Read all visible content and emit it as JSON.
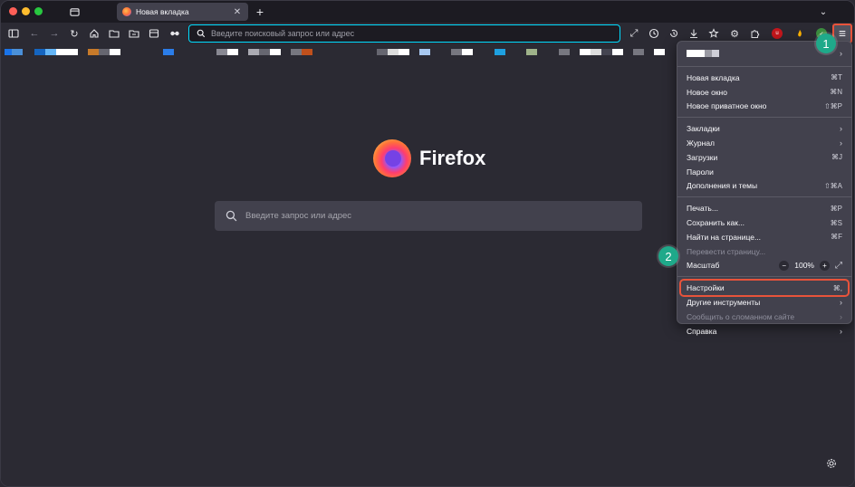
{
  "tab": {
    "title": "Новая вкладка",
    "close": "✕"
  },
  "newtab": "+",
  "tablist": "⌄",
  "urlbar": {
    "placeholder": "Введите поисковый запрос или адрес"
  },
  "content": {
    "brand": "Firefox",
    "search_placeholder": "Введите запрос или адрес"
  },
  "colors": {
    "accent": "#00ddff",
    "highlight": "#e8533b",
    "badge": "#1fa98a"
  },
  "app_menu": {
    "items_group1": [
      {
        "label": "Новая вкладка",
        "shortcut": "⌘T"
      },
      {
        "label": "Новое окно",
        "shortcut": "⌘N"
      },
      {
        "label": "Новое приватное окно",
        "shortcut": "⇧⌘P"
      }
    ],
    "items_group2": [
      {
        "label": "Закладки",
        "shortcut": "›"
      },
      {
        "label": "Журнал",
        "shortcut": "›"
      },
      {
        "label": "Загрузки",
        "shortcut": "⌘J"
      },
      {
        "label": "Пароли",
        "shortcut": ""
      },
      {
        "label": "Дополнения и темы",
        "shortcut": "⇧⌘A"
      }
    ],
    "items_group3": [
      {
        "label": "Печать...",
        "shortcut": "⌘P"
      },
      {
        "label": "Сохранить как...",
        "shortcut": "⌘S"
      },
      {
        "label": "Найти на странице...",
        "shortcut": "⌘F"
      },
      {
        "label": "Перевести страницу...",
        "shortcut": ""
      }
    ],
    "zoom": {
      "label": "Масштаб",
      "minus": "−",
      "value": "100%",
      "plus": "+",
      "fullscreen": "⤢"
    },
    "items_group4": [
      {
        "label": "Настройки",
        "shortcut": "⌘,"
      },
      {
        "label": "Другие инструменты",
        "shortcut": "›"
      },
      {
        "label": "Сообщить о сломанном сайте",
        "shortcut": "›"
      },
      {
        "label": "Справка",
        "shortcut": "›"
      }
    ]
  },
  "badges": {
    "one": "1",
    "two": "2"
  }
}
